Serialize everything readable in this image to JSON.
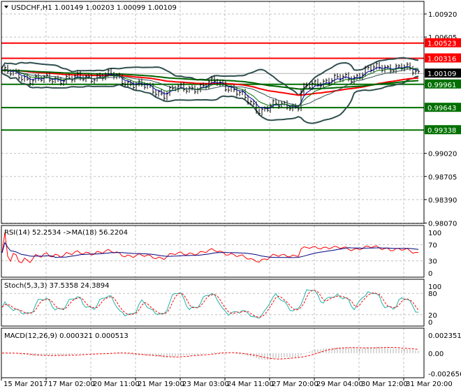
{
  "header": {
    "symbol_line": "USDCHF,H1  1.00149 1.00203 1.00099 1.00109"
  },
  "price_axis": {
    "ticks": [
      "1.00920",
      "1.00605",
      "0.99020",
      "0.98705",
      "0.98390",
      "0.98070"
    ]
  },
  "levels": [
    {
      "label": "1.00523",
      "price": 1.00523,
      "color": "#ff0000"
    },
    {
      "label": "1.00316",
      "price": 1.00316,
      "color": "#ff0000"
    },
    {
      "label": "0.99961",
      "price": 0.99961,
      "color": "#007000"
    },
    {
      "label": "0.99643",
      "price": 0.99643,
      "color": "#007000"
    },
    {
      "label": "0.99338",
      "price": 0.99338,
      "color": "#007000"
    }
  ],
  "bid": {
    "label": "1.00109",
    "price": 1.00109
  },
  "rsi": {
    "label": "RSI(14) 52.2534  ->MA(18) 56.2204",
    "ticks": [
      "100",
      "70",
      "30",
      "0"
    ]
  },
  "stoch": {
    "label": "Stoch(5,3,3) 37.5358 24.3894",
    "ticks": [
      "100",
      "80",
      "20",
      "0"
    ]
  },
  "macd": {
    "label": "MACD(12,26,9) 0.000321 0.000513",
    "ticks": [
      "0.002351",
      "0.00",
      "-0.002656"
    ]
  },
  "time_axis": {
    "labels": [
      "15 Mar 2017",
      "17 Mar 02:00",
      "20 Mar 11:00",
      "21 Mar 19:00",
      "23 Mar 03:00",
      "24 Mar 11:00",
      "27 Mar 20:00",
      "29 Mar 04:00",
      "30 Mar 12:00",
      "31 Mar 20:00"
    ]
  },
  "chart_data": {
    "type": "line",
    "title": "USDCHF,H1",
    "ylim": [
      0.9807,
      1.0092
    ],
    "close_anchors": [
      [
        0,
        1.0015
      ],
      [
        0.066,
        1.0003
      ],
      [
        0.13,
        1.0003
      ],
      [
        0.2,
        1.0005
      ],
      [
        0.265,
        1.0009
      ],
      [
        0.306,
        0.9997
      ],
      [
        0.347,
        0.9993
      ],
      [
        0.388,
        0.9982
      ],
      [
        0.413,
        0.999
      ],
      [
        0.48,
        0.9992
      ],
      [
        0.512,
        1.0001
      ],
      [
        0.545,
        0.9992
      ],
      [
        0.578,
        0.998
      ],
      [
        0.62,
        0.996
      ],
      [
        0.653,
        0.9968
      ],
      [
        0.694,
        0.9968
      ],
      [
        0.71,
        0.9963
      ],
      [
        0.719,
        0.9989
      ],
      [
        0.76,
        0.9998
      ],
      [
        0.793,
        1.0004
      ],
      [
        0.843,
        1.0004
      ],
      [
        0.876,
        1.0017
      ],
      [
        0.926,
        1.0019
      ],
      [
        0.96,
        1.002
      ],
      [
        1,
        1.0011
      ]
    ],
    "colors": {
      "bars": "#000000",
      "ma_fast": "#0000a0",
      "ma_mid": "#007000",
      "ma_red": "#ff0000",
      "ma_slow": "#006400",
      "bands": "#2f4f4f"
    }
  }
}
